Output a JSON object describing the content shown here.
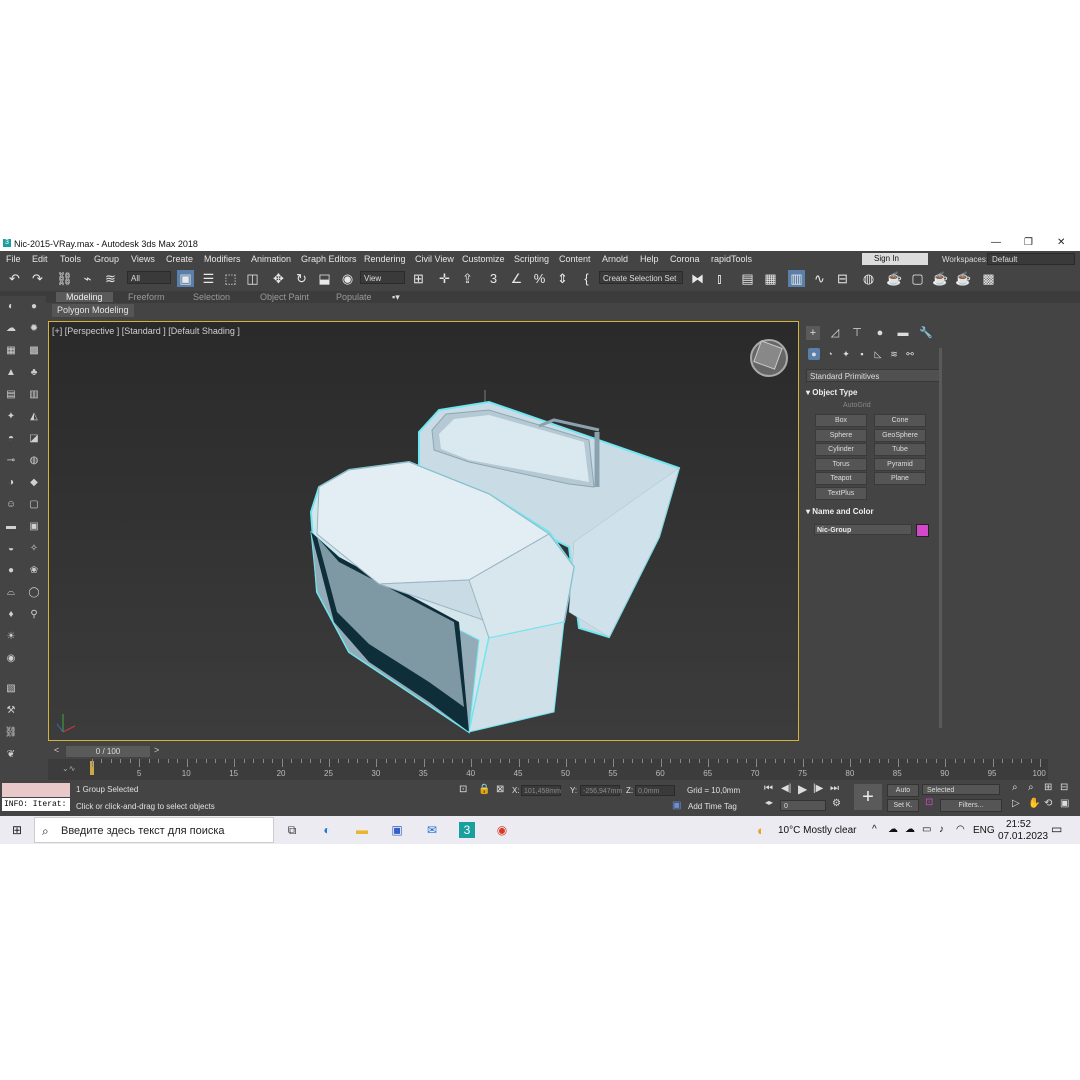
{
  "window": {
    "title": "Nic-2015-VRay.max - Autodesk 3ds Max 2018",
    "min": "—",
    "max": "❐",
    "close": "✕"
  },
  "menu": [
    "File",
    "Edit",
    "Tools",
    "Group",
    "Views",
    "Create",
    "Modifiers",
    "Animation",
    "Graph Editors",
    "Rendering",
    "Civil View",
    "Customize",
    "Scripting",
    "Content",
    "Arnold",
    "Help",
    "Corona",
    "rapidTools"
  ],
  "account": {
    "signin": "Sign In",
    "workspaces_label": "Workspaces:",
    "workspace": "Default"
  },
  "toolbar": {
    "filter": "All",
    "refcoord": "View",
    "selection_set": "Create Selection Set"
  },
  "ribbon": {
    "tabs": [
      "Modeling",
      "Freeform",
      "Selection",
      "Object Paint",
      "Populate"
    ],
    "subtab": "Polygon Modeling"
  },
  "viewport": {
    "label": "[+] [Perspective ] [Standard ] [Default Shading ]"
  },
  "command_panel": {
    "category": "Standard Primitives",
    "object_type_header": "Object Type",
    "autogrid": "AutoGrid",
    "primitives": [
      "Box",
      "Cone",
      "Sphere",
      "GeoSphere",
      "Cylinder",
      "Tube",
      "Torus",
      "Pyramid",
      "Teapot",
      "Plane",
      "TextPlus"
    ],
    "name_color_header": "Name and Color",
    "object_name": "Nic-Group",
    "object_color": "#d248c8"
  },
  "timeline": {
    "frame_display": "0 / 100",
    "ticks": [
      "5",
      "10",
      "15",
      "20",
      "25",
      "30",
      "35",
      "40",
      "45",
      "50",
      "55",
      "60",
      "65",
      "70",
      "75",
      "80",
      "85",
      "90",
      "95",
      "100"
    ]
  },
  "status": {
    "maxscript_line": "INFO: Iterat:",
    "selected": "1 Group Selected",
    "prompt": "Click or click-and-drag to select objects",
    "x_label": "X:",
    "x_value": "101,458mm",
    "y_label": "Y:",
    "y_value": "-256,947mm",
    "z_label": "Z:",
    "z_value": "0,0mm",
    "grid": "Grid = 10,0mm",
    "add_time_tag": "Add Time Tag",
    "auto": "Auto",
    "setk": "Set K.",
    "key_filter": "Selected",
    "filters": "Filters...",
    "frame_spinner": "0"
  },
  "taskbar": {
    "search_placeholder": "Введите здесь текст для поиска",
    "weather": "10°C  Mostly clear",
    "lang": "ENG",
    "time": "21:52",
    "date": "07.01.2023"
  }
}
